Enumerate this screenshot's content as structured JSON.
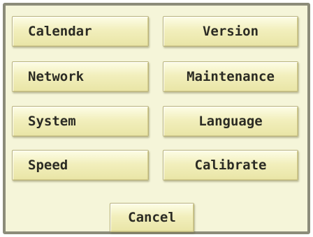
{
  "menu": {
    "left_buttons": [
      "Calendar",
      "Network",
      "System",
      "Speed"
    ],
    "right_buttons": [
      "Version",
      "Maintenance",
      "Language",
      "Calibrate"
    ],
    "cancel_label": "Cancel"
  }
}
